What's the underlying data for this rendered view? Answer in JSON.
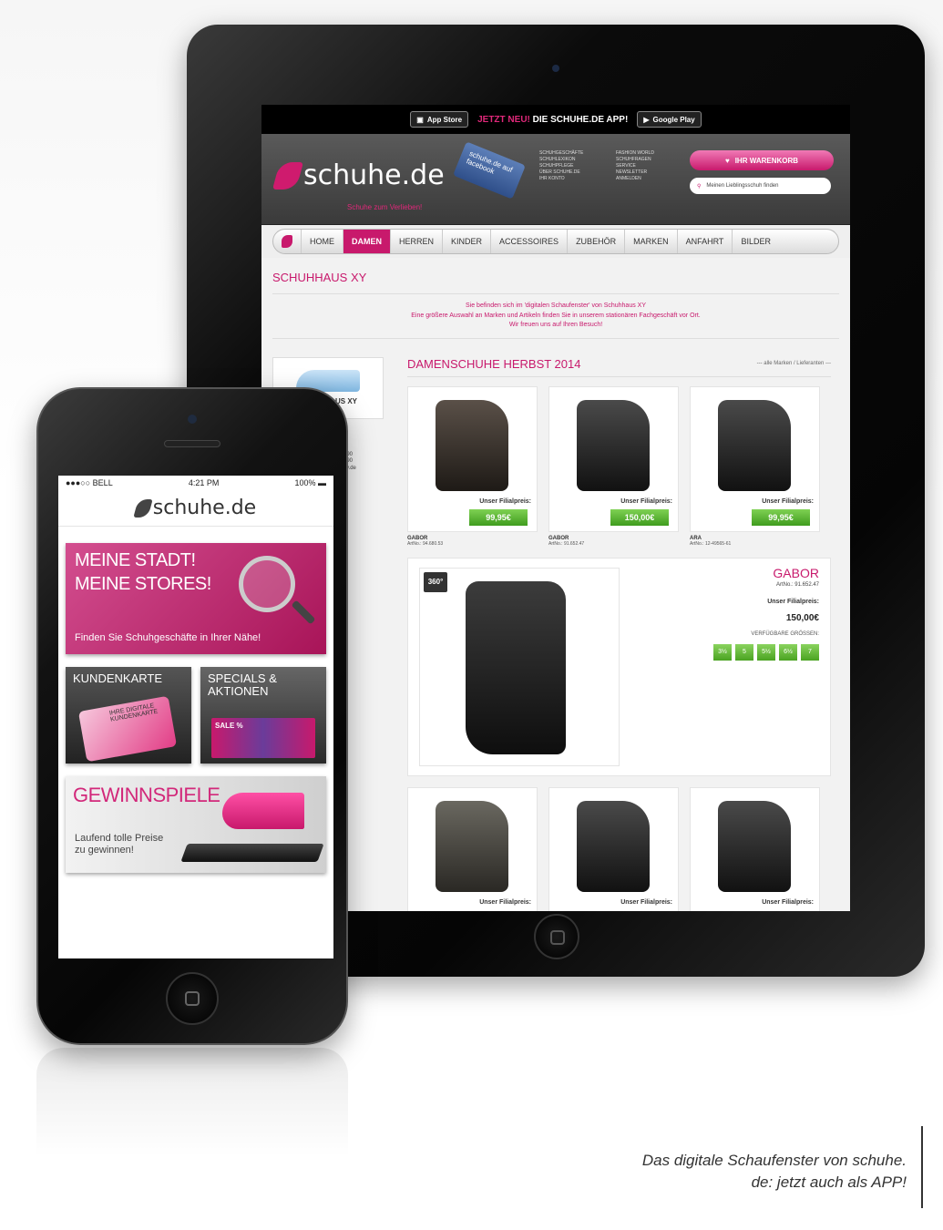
{
  "tablet": {
    "promo": {
      "app_store": "App Store",
      "google_play": "Google Play",
      "text_pink": "JETZT NEU!",
      "text_white": "DIE SCHUHE.DE APP!"
    },
    "header": {
      "logo_text": "schuhe.de",
      "logo_sub": "Schuhe zum Verlieben!",
      "fb_tag": "schuhe.de auf facebook",
      "links": [
        "SCHUHGESCHÄFTE",
        "FASHION WORLD",
        "SCHUHLEXIKON",
        "SCHUHFRAGEN",
        "SCHUHPFLEGE",
        "SERVICE",
        "ÜBER SCHUHE.DE",
        "NEWSLETTER",
        "IHR KONTO",
        "ANMELDEN"
      ],
      "cart_label": "IHR WARENKORB",
      "search_placeholder": "Meinen Lieblingsschuh finden"
    },
    "nav": {
      "items": [
        "HOME",
        "DAMEN",
        "HERREN",
        "KINDER",
        "ACCESSOIRES",
        "ZUBEHÖR",
        "MARKEN",
        "ANFAHRT",
        "BILDER"
      ],
      "active": "DAMEN"
    },
    "shop_title": "SCHUHHAUS XY",
    "intro": [
      "Sie befinden sich im 'digitalen Schaufenster' von Schuhhaus XY",
      "Eine größere Auswahl an Marken und Artikeln finden Sie in unserem stationären Fachgeschäft vor Ort.",
      "Wir freuen uns auf Ihren Besuch!"
    ],
    "sidebar": {
      "shop_label": "SCHUHHAUS XY",
      "lines": [
        "890",
        "890",
        "xy.de",
        "890",
        "890"
      ]
    },
    "section": {
      "title": "DAMENSCHUHE HERBST 2014",
      "filter": "--- alle Marken / Lieferanten ---"
    },
    "products": [
      {
        "price_label": "Unser Filialpreis:",
        "price": "99,95€",
        "brand": "GABOR",
        "art": "ArtNo.: 94.680.53",
        "color": "brown"
      },
      {
        "price_label": "Unser Filialpreis:",
        "price": "150,00€",
        "brand": "GABOR",
        "art": "ArtNo.: 91.652.47",
        "color": "black"
      },
      {
        "price_label": "Unser Filialpreis:",
        "price": "99,95€",
        "brand": "ARA",
        "art": "ArtNo.: 12-49565-61",
        "color": "black"
      }
    ],
    "feature": {
      "badge": "360°",
      "brand": "GABOR",
      "art": "ArtNo.: 91.652.47",
      "price_label": "Unser Filialpreis:",
      "price": "150,00€",
      "sizes_label": "VERFÜGBARE GRÖSSEN:",
      "sizes": [
        "3½",
        "5",
        "5½",
        "6½",
        "7"
      ]
    },
    "products_second": [
      {
        "price_label": "Unser Filialpreis:",
        "color": "grey"
      },
      {
        "price_label": "Unser Filialpreis:",
        "color": "black"
      },
      {
        "price_label": "Unser Filialpreis:",
        "color": "black"
      }
    ]
  },
  "phone": {
    "status": {
      "carrier": "●●●○○ BELL",
      "time": "4:21 PM",
      "battery": "100%"
    },
    "logo_text": "schuhe.de",
    "stores_tile": {
      "line1": "MEINE STADT!",
      "line2": "MEINE STORES!",
      "sub": "Finden Sie Schuhgeschäfte in Ihrer Nähe!"
    },
    "card_tile": {
      "title": "KUNDENKARTE",
      "card_text": "IHRE DIGITALE KUNDENKARTE"
    },
    "specials_tile": {
      "title_line1": "SPECIALS &",
      "title_line2": "AKTIONEN",
      "sale": "SALE %"
    },
    "win_tile": {
      "title": "GEWINNSPIELE",
      "sub_line1": "Laufend tolle Preise",
      "sub_line2": "zu gewinnen!"
    }
  },
  "caption": {
    "line1": "Das digitale Schaufenster von schuhe.",
    "line2": "de: jetzt auch als APP!"
  },
  "colors": {
    "brand_pink": "#c8196c",
    "price_green": "#4aa321"
  }
}
